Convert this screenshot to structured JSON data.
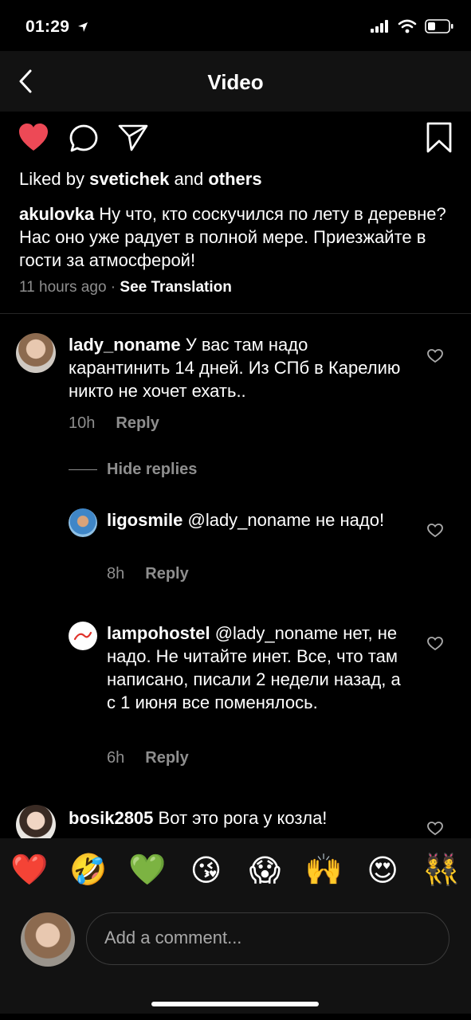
{
  "status_bar": {
    "time": "01:29",
    "location_icon": "location-arrow-icon",
    "signal_icon": "cellular-signal-icon",
    "wifi_icon": "wifi-icon",
    "battery_icon": "battery-icon"
  },
  "header": {
    "back_icon": "chevron-left-icon",
    "title": "Video"
  },
  "actions": {
    "like_icon": "heart-filled-icon",
    "comment_icon": "comment-bubble-icon",
    "share_icon": "paper-plane-icon",
    "save_icon": "bookmark-icon",
    "like_color": "#ed4956"
  },
  "post": {
    "liked_prefix": "Liked by",
    "liked_user": "svetichek",
    "liked_and": "and",
    "liked_others": "others",
    "author": "akulovka",
    "caption": "Ну что, кто соскучился по лету в деревне? Нас оно уже радует в полной мере. Приезжайте в гости за атмосферой!",
    "time": "11 hours ago",
    "separator": "·",
    "see_translation": "See Translation"
  },
  "comments": [
    {
      "user": "lady_noname",
      "text": "У вас там надо карантинить 14 дней. Из СПб в Карелию никто не хочет ехать..",
      "time": "10h",
      "reply_label": "Reply"
    },
    {
      "user": "bosik2805",
      "text": "Вот это рога у козла!",
      "time": "",
      "reply_label": ""
    }
  ],
  "hide_replies": "Hide replies",
  "replies": [
    {
      "user": "ligosmile",
      "text": "@lady_noname не надо!",
      "time": "8h",
      "reply_label": "Reply"
    },
    {
      "user": "lampohostel",
      "text": "@lady_noname нет, не надо. Не читайте инет. Все, что там написано, писали 2 недели назад, а с 1 июня все поменялось.",
      "time": "6h",
      "reply_label": "Reply"
    }
  ],
  "emoji_bar": [
    "❤️",
    "🤣",
    "💚",
    "😘",
    "😱",
    "🙌",
    "😍",
    "👯"
  ],
  "composer": {
    "placeholder": "Add a comment..."
  }
}
